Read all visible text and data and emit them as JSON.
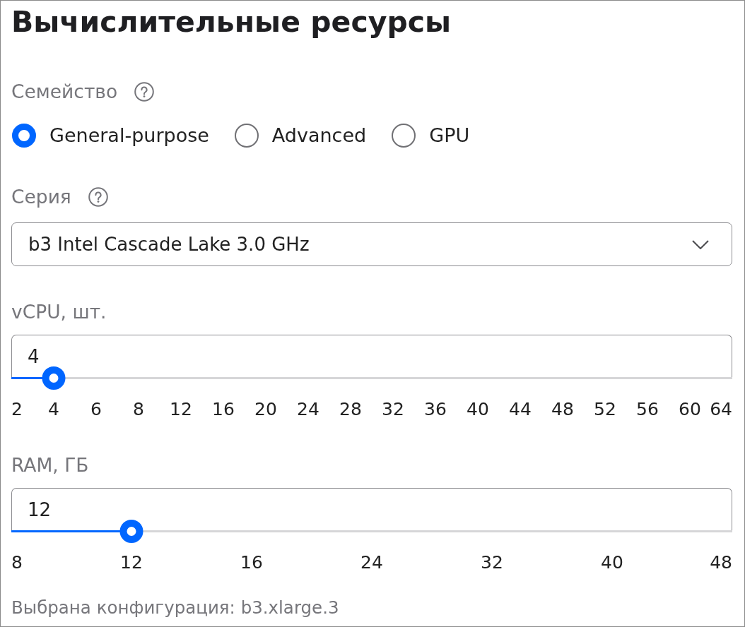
{
  "title": "Вычислительные ресурсы",
  "family": {
    "label": "Семейство",
    "help": true,
    "options": [
      {
        "label": "General-purpose",
        "selected": true
      },
      {
        "label": "Advanced",
        "selected": false
      },
      {
        "label": "GPU",
        "selected": false
      }
    ]
  },
  "series": {
    "label": "Серия",
    "help": true,
    "value": "b3 Intel Cascade Lake 3.0 GHz"
  },
  "sliders": [
    {
      "label": "vCPU, шт.",
      "value": "4",
      "level": 0.0588,
      "ticks": [
        "2",
        "4",
        "6",
        "8",
        "12",
        "16",
        "20",
        "24",
        "28",
        "32",
        "36",
        "40",
        "44",
        "48",
        "52",
        "56",
        "60",
        "64"
      ]
    },
    {
      "label": "RAM, ГБ",
      "value": "12",
      "level": 0.1667,
      "ticks": [
        "8",
        "12",
        "16",
        "24",
        "32",
        "40",
        "48"
      ]
    }
  ],
  "summary": "Выбрана конфигурация: b3.xlarge.3"
}
